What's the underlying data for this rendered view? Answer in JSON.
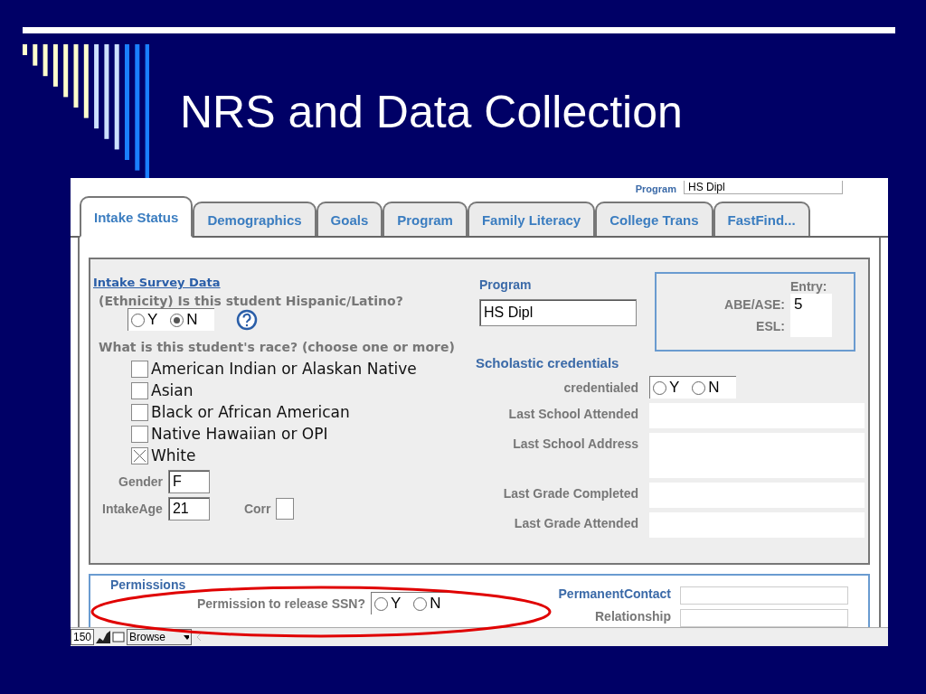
{
  "slide": {
    "title": "NRS and Data Collection"
  },
  "screen": {
    "header": {
      "label": "Program",
      "value": "HS Dipl"
    },
    "tabs": [
      {
        "label": "Intake Status",
        "selected": true
      },
      {
        "label": "Demographics",
        "selected": false
      },
      {
        "label": "Goals",
        "selected": false
      },
      {
        "label": "Program",
        "selected": false
      },
      {
        "label": "Family Literacy",
        "selected": false
      },
      {
        "label": "College Trans",
        "selected": false
      },
      {
        "label": "FastFind...",
        "selected": false
      }
    ],
    "intake": {
      "link": "Intake Survey Data",
      "ethnicity_question": "(Ethnicity) Is this student Hispanic/Latino?",
      "ethnicity_options": [
        {
          "label": "Y",
          "selected": false
        },
        {
          "label": "N",
          "selected": true
        }
      ],
      "race_question": "What is this student's race? (choose one or more)",
      "races": [
        {
          "label": "American Indian or Alaskan Native",
          "checked": false
        },
        {
          "label": "Asian",
          "checked": false
        },
        {
          "label": "Black or African American",
          "checked": false
        },
        {
          "label": "Native Hawaiian or OPI",
          "checked": false
        },
        {
          "label": "White",
          "checked": true
        }
      ],
      "gender": {
        "label": "Gender",
        "value": "F"
      },
      "intake_age": {
        "label": "IntakeAge",
        "value": "21"
      },
      "corr": {
        "label": "Corr",
        "checked": false
      }
    },
    "program": {
      "label": "Program",
      "value": "HS Dipl"
    },
    "entry": {
      "title": "Entry:",
      "rows": [
        {
          "label": "ABE/ASE:",
          "value": "5"
        },
        {
          "label": "ESL:"
        }
      ]
    },
    "credentials": {
      "title": "Scholastic credentials",
      "credentialed": {
        "label": "credentialed",
        "options": [
          {
            "label": "Y",
            "selected": false
          },
          {
            "label": "N",
            "selected": false
          }
        ]
      },
      "fields": [
        {
          "label": "Last School Attended",
          "kind": "line"
        },
        {
          "label": "Last School Address",
          "kind": "area"
        },
        {
          "label": "Last Grade Completed",
          "kind": "line"
        },
        {
          "label": "Last Grade Attended",
          "kind": "line"
        }
      ]
    },
    "permissions": {
      "title": "Permissions",
      "ssn": {
        "label": "Permission to release SSN?",
        "options": [
          {
            "label": "Y",
            "selected": false
          },
          {
            "label": "N",
            "selected": false
          }
        ]
      },
      "contacts": [
        {
          "label": "PermanentContact",
          "kind": "title"
        },
        {
          "label": "Relationship",
          "kind": "label"
        }
      ]
    },
    "status_bar": {
      "record": "150",
      "mode": "Browse"
    }
  }
}
